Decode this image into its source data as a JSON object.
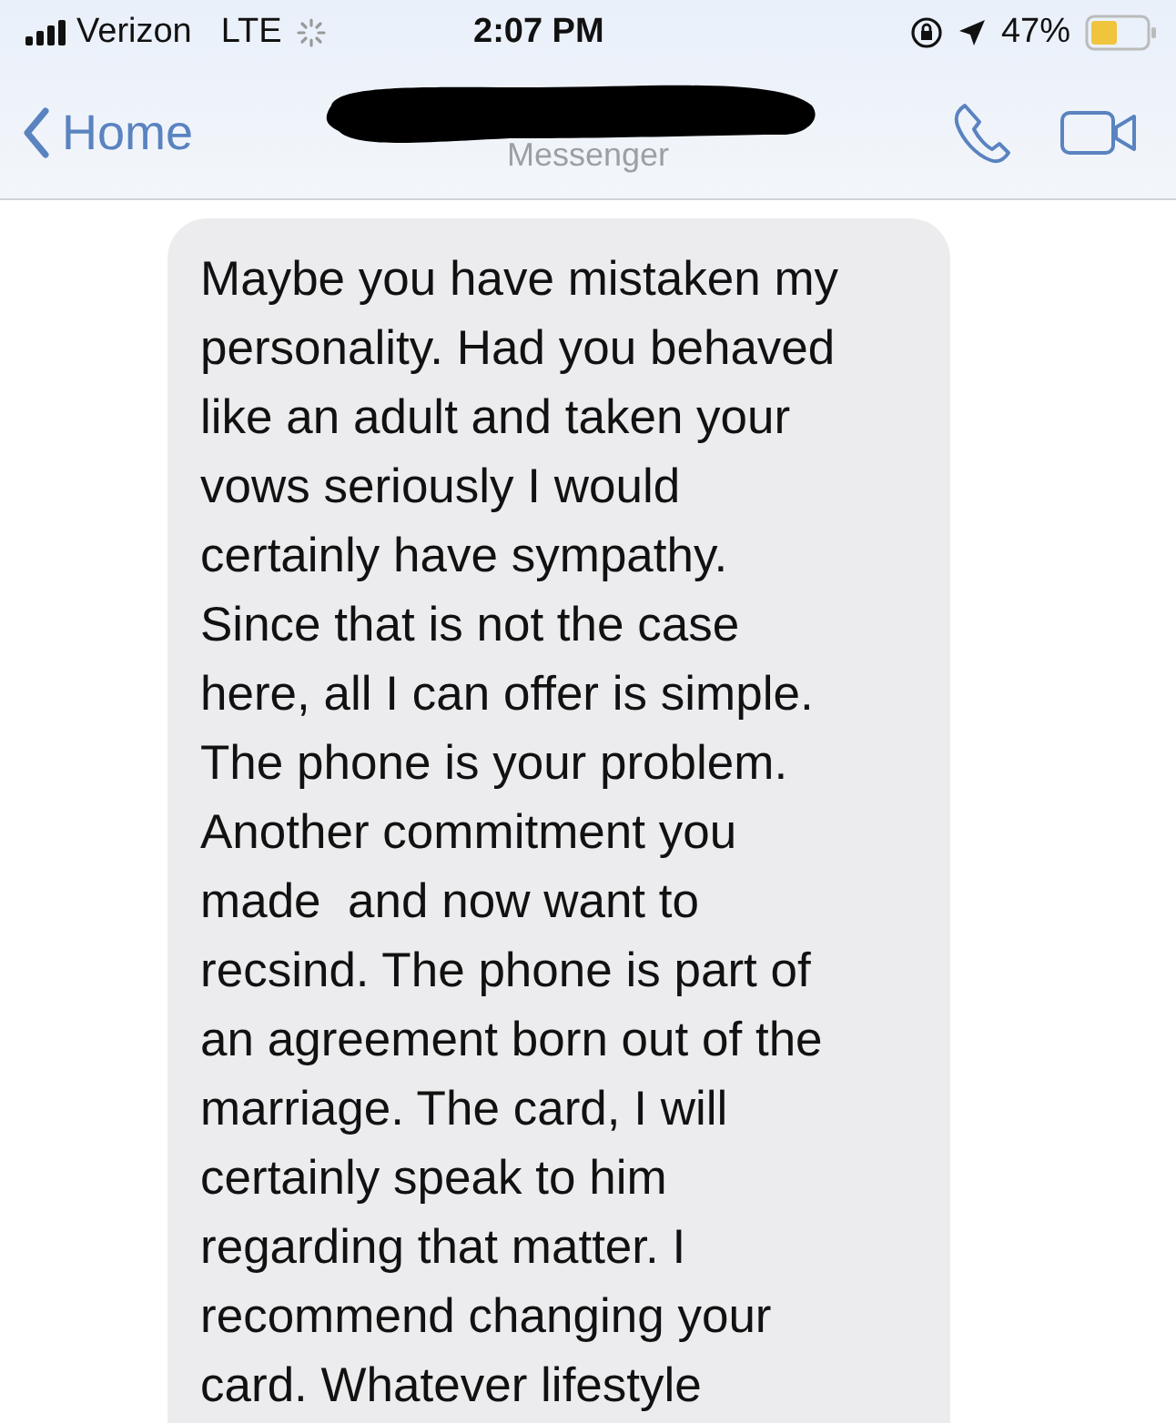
{
  "status_bar": {
    "carrier": "Verizon",
    "network": "LTE",
    "time": "2:07 PM",
    "battery": "47%"
  },
  "nav_bar": {
    "back_label": "Home",
    "subtitle": "Messenger"
  },
  "messages": [
    {
      "kind": "incoming",
      "text": "Maybe you have mistaken my\npersonality. Had you behaved\nlike an adult and taken your\nvows seriously I would\ncertainly have sympathy.\nSince that is not the case\nhere, all I can offer is simple.\nThe phone is your problem.\nAnother commitment you\nmade  and now want to\nrecsind. The phone is part of\nan agreement born out of the\nmarriage. The card, I will\ncertainly speak to him\nregarding that matter. I\nrecommend changing your\ncard. Whatever lifestyle"
    }
  ]
}
